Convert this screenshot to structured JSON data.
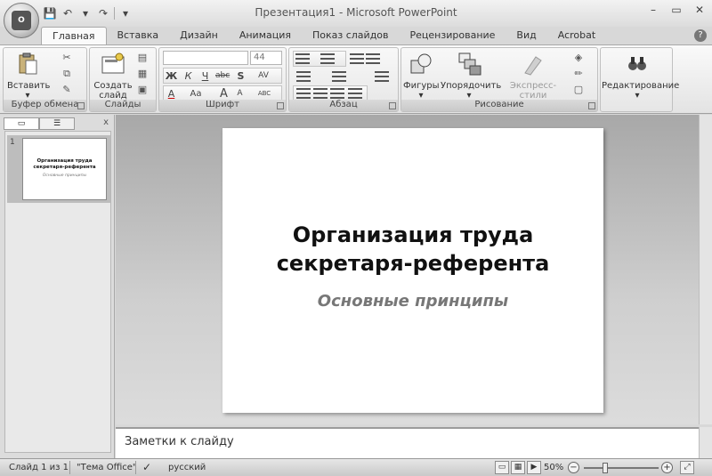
{
  "window": {
    "title": "Презентация1 - Microsoft PowerPoint",
    "minimize": "–",
    "restore": "▭",
    "close": "✕",
    "office_logo": "O"
  },
  "qat": {
    "save": "💾",
    "undo": "↶",
    "undo_drop": "▾",
    "redo": "↷",
    "customize": "▾"
  },
  "tabs": [
    "Главная",
    "Вставка",
    "Дизайн",
    "Анимация",
    "Показ слайдов",
    "Рецензирование",
    "Вид",
    "Acrobat"
  ],
  "help": "?",
  "ribbon": {
    "groups": {
      "clipboard": "Буфер обмена",
      "slides": "Слайды",
      "font": "Шрифт",
      "paragraph": "Абзац",
      "drawing": "Рисование"
    },
    "paste": "Вставить",
    "new_slide_line1": "Создать",
    "new_slide_line2": "слайд",
    "font_name": "",
    "font_size": "44",
    "bold": "Ж",
    "italic": "К",
    "underline": "Ч",
    "strike": "abc",
    "shadow": "S",
    "spacing": "AV",
    "case": "Aa",
    "grow": "A",
    "shrink": "A",
    "clear": "ABC",
    "font_color": "A",
    "shapes": "Фигуры",
    "arrange": "Упорядочить",
    "quick_styles": "Экспресс-стили",
    "editing": "Редактирование"
  },
  "left_panel": {
    "close": "x",
    "slide_number": "1",
    "thumb_title": "Организация труда секретаря-референта",
    "thumb_sub": "Основные принципы"
  },
  "slide": {
    "title_line1": "Организация труда",
    "title_line2": "секретаря-референта",
    "subtitle": "Основные принципы"
  },
  "notes": {
    "placeholder": "Заметки к слайду"
  },
  "status": {
    "slide_info": "Слайд 1 из 1",
    "theme": "\"Тема Office\"",
    "language": "русский",
    "zoom": "50%",
    "zoom_level": 0.5
  }
}
